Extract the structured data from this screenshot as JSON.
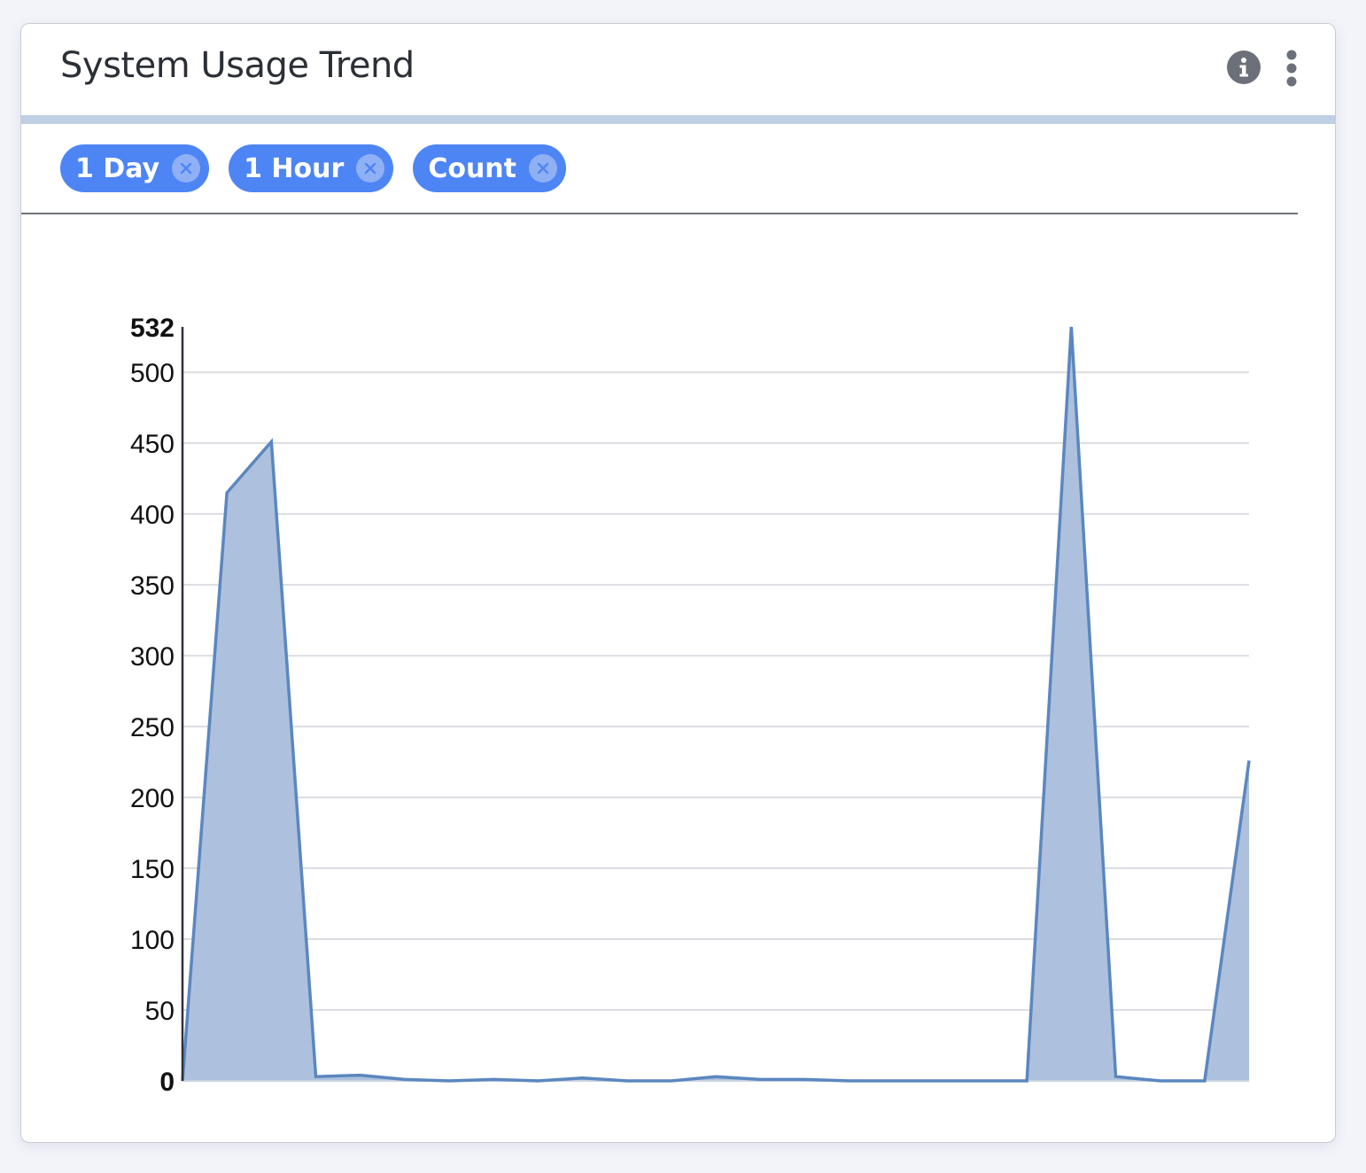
{
  "card": {
    "title": "System Usage Trend",
    "icons": [
      "info-icon",
      "more-vertical-icon"
    ]
  },
  "filters": [
    {
      "label": "1 Day",
      "icon": "close-circle-icon"
    },
    {
      "label": "1 Hour",
      "icon": "close-circle-icon"
    },
    {
      "label": "Count",
      "icon": "close-circle-icon"
    }
  ],
  "colors": {
    "chip": "#4e85f5",
    "series_line": "#5b87bf",
    "series_fill": "#adc1de",
    "header_rule": "#bfd0e5"
  },
  "chart_data": {
    "type": "area",
    "title": "",
    "xlabel": "",
    "ylabel": "",
    "ylim": [
      0,
      532
    ],
    "y_ticks": [
      0,
      50,
      100,
      150,
      200,
      250,
      300,
      350,
      400,
      450,
      500,
      532
    ],
    "y_tick_labels": [
      "0",
      "50",
      "100",
      "150",
      "200",
      "250",
      "300",
      "350",
      "400",
      "450",
      "500",
      "532"
    ],
    "bold_ticks": [
      "0",
      "532"
    ],
    "grid": true,
    "legend": "none",
    "series": [
      {
        "values": [
          0,
          415,
          451,
          3,
          4,
          1,
          0,
          1,
          0,
          2,
          0,
          0,
          3,
          1,
          1,
          0,
          0,
          0,
          0,
          0,
          532,
          3,
          0,
          0,
          226
        ]
      }
    ]
  }
}
